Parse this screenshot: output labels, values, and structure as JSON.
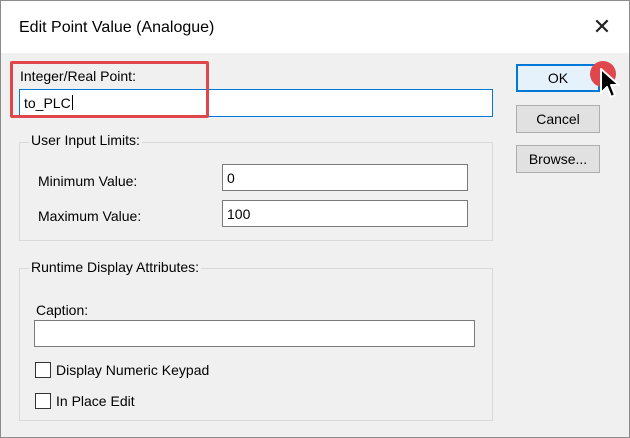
{
  "dialog": {
    "title": "Edit Point Value (Analogue)",
    "close_glyph": "✕"
  },
  "point": {
    "label": "Integer/Real Point:",
    "value": "to_PLC"
  },
  "buttons": {
    "ok": "OK",
    "cancel": "Cancel",
    "browse": "Browse..."
  },
  "user_input_limits": {
    "group_title": "User Input Limits:",
    "min_label": "Minimum Value:",
    "min_value": "0",
    "max_label": "Maximum Value:",
    "max_value": "100"
  },
  "runtime": {
    "group_title": "Runtime Display Attributes:",
    "caption_label": "Caption:",
    "caption_value": "",
    "keypad_label": "Display Numeric Keypad",
    "keypad_checked": false,
    "inplace_label": "In Place Edit",
    "inplace_checked": false
  },
  "annotations": {
    "highlight_color": "#e0474c",
    "accent_color": "#0078d7",
    "cursor_icon": "arrow-cursor-icon"
  }
}
